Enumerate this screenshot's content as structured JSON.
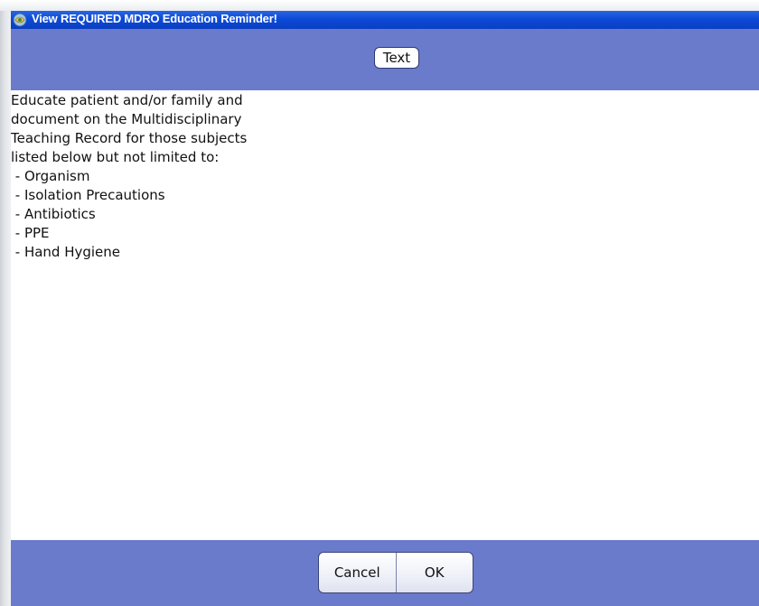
{
  "window": {
    "title": "View REQUIRED MDRO Education Reminder!",
    "icon": "app-icon"
  },
  "header": {
    "tab_label": "Text"
  },
  "content": {
    "lines": [
      "Educate patient and/or family and",
      "document on the Multidisciplinary",
      "Teaching Record for those subjects",
      "listed below but not limited to:",
      " - Organism",
      " - Isolation Precautions",
      " - Antibiotics",
      " - PPE",
      " - Hand Hygiene"
    ]
  },
  "footer": {
    "cancel_label": "Cancel",
    "ok_label": "OK"
  },
  "colors": {
    "band": "#6a7bcc",
    "title_bar": "#0c4ad8"
  }
}
